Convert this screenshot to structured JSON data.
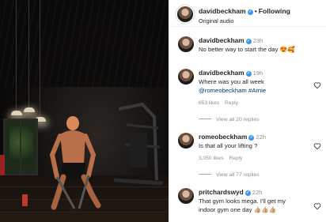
{
  "post": {
    "author": "davidbeckham",
    "follow_status": "Following",
    "audio": "Original audio"
  },
  "comments": [
    {
      "username": "davidbeckham",
      "time": "23h",
      "text": "No better way to start the day 😍🥰",
      "has_like": false
    },
    {
      "username": "davidbeckham",
      "time": "19h",
      "text_line1": "Where was you all week",
      "mention1": "@romeobeckham",
      "mention2": "#Arnie",
      "likes": "653 likes",
      "reply_label": "Reply",
      "view_replies": "View all 20 replies"
    },
    {
      "username": "romeobeckham",
      "time": "22h",
      "text": "Is that all your lifting ?",
      "likes": "3,050 likes",
      "reply_label": "Reply",
      "view_replies": "View all 77 replies"
    },
    {
      "username": "pritchardswyd",
      "time": "22h",
      "text_line1": "That gym looks mega. I'll get my",
      "text_line2": "indoor gym one day 👍🏼👍🏼👍🏼"
    }
  ],
  "icons": {
    "verified": "verified-badge-icon",
    "like": "heart-outline-icon"
  },
  "colors": {
    "verified_blue": "#3897f0",
    "text": "#262626",
    "secondary_text": "#8e8e8e",
    "mention": "#00376b"
  }
}
